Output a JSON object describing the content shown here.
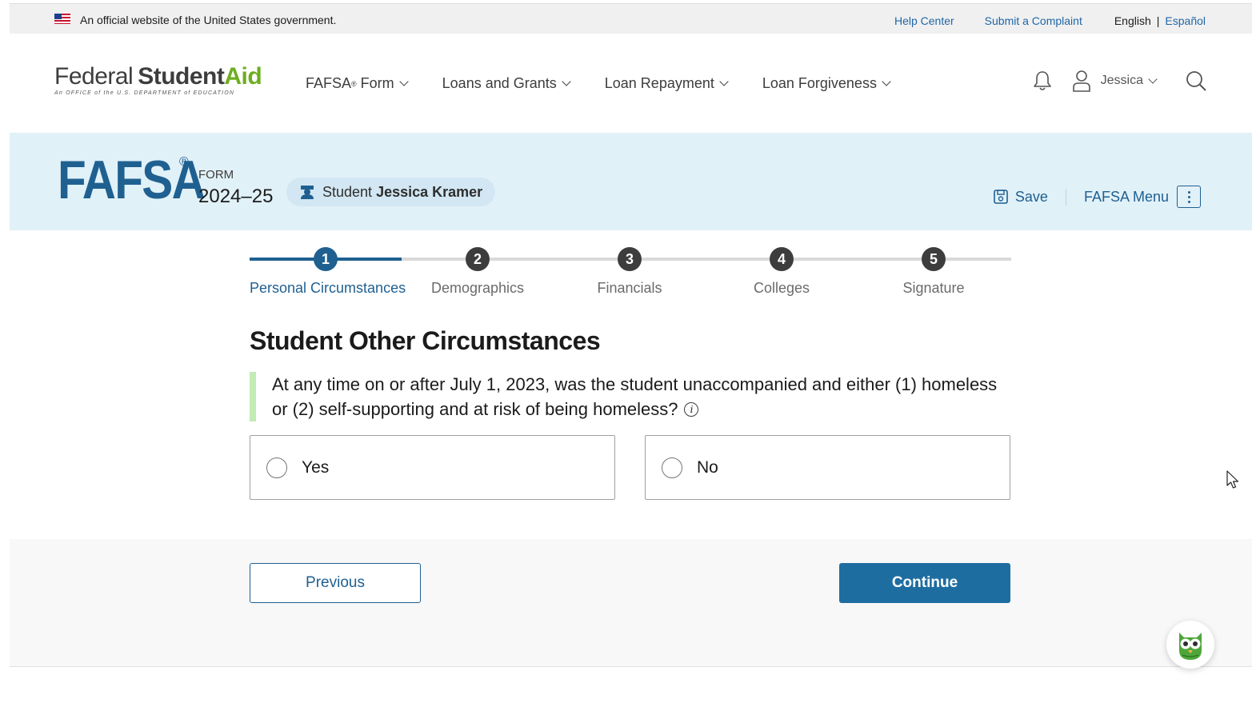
{
  "gov_banner": {
    "text": "An official website of the United States government.",
    "help_center": "Help Center",
    "submit_complaint": "Submit a Complaint",
    "lang_current": "English",
    "lang_separator": "|",
    "lang_alt": "Español"
  },
  "logo": {
    "federal": "Federal",
    "student": "Student",
    "aid": "Aid",
    "subtitle": "An OFFICE of the U.S. DEPARTMENT of EDUCATION"
  },
  "nav": {
    "fafsa_form": "FAFSA",
    "fafsa_form_sup": "®",
    "fafsa_form_suffix": " Form",
    "loans_grants": "Loans and Grants",
    "loan_repayment": "Loan Repayment",
    "loan_forgiveness": "Loan Forgiveness"
  },
  "user": {
    "name": "Jessica"
  },
  "form_banner": {
    "logo_text": "FAFSA",
    "logo_reg": "®",
    "form_label": "FORM",
    "form_year": "2024–25",
    "role": "Student",
    "student_name": "Jessica Kramer",
    "save": "Save",
    "menu": "FAFSA Menu"
  },
  "stepper": {
    "current": 1,
    "steps": [
      {
        "num": "1",
        "label": "Personal Circumstances"
      },
      {
        "num": "2",
        "label": "Demographics"
      },
      {
        "num": "3",
        "label": "Financials"
      },
      {
        "num": "4",
        "label": "Colleges"
      },
      {
        "num": "5",
        "label": "Signature"
      }
    ]
  },
  "page": {
    "heading": "Student Other Circumstances",
    "question": "At any time on or after July 1, 2023, was the student unaccompanied and either (1) homeless or (2) self-supporting and at risk of being homeless?",
    "info_icon": "i",
    "options": {
      "yes": "Yes",
      "no": "No"
    }
  },
  "actions": {
    "previous": "Previous",
    "continue": "Continue"
  },
  "colors": {
    "brand_blue": "#1f6091",
    "link_blue": "#1f67a7",
    "banner_bg": "#e1f1f8",
    "green_accent": "#6dae1f",
    "continue_bg": "#1e6da1"
  }
}
